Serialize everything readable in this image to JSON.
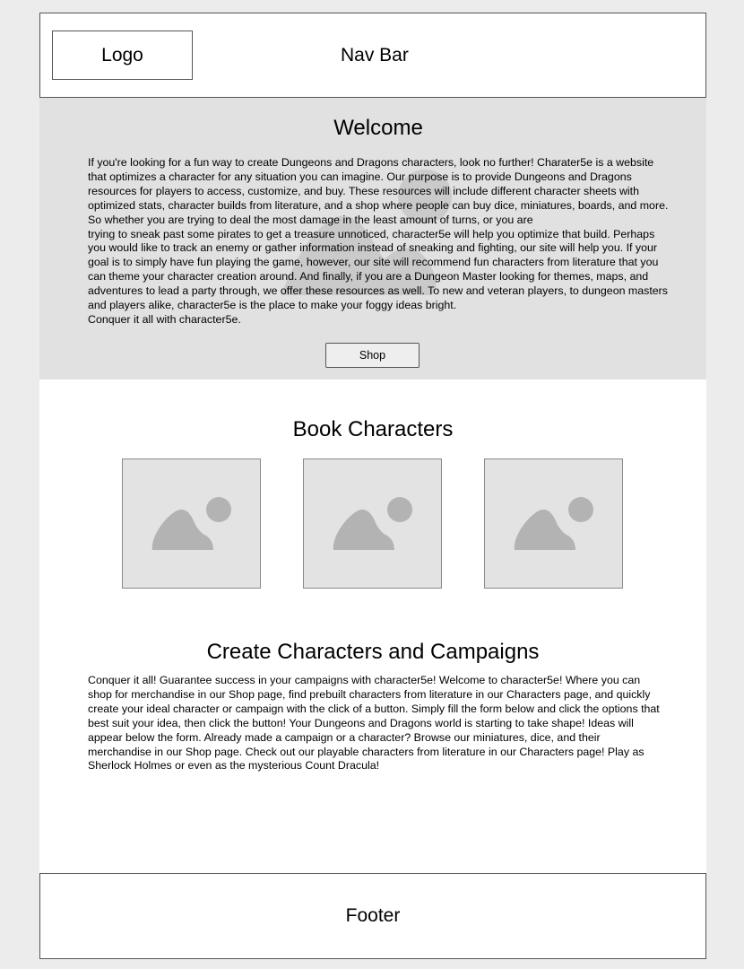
{
  "navbar": {
    "logo_label": "Logo",
    "nav_label": "Nav Bar"
  },
  "welcome": {
    "title": "Welcome",
    "body": "If you're looking for a fun way to create Dungeons and Dragons characters, look no further! Charater5e is a website\nthat optimizes a character for any situation you can imagine. Our purpose is to provide Dungeons and Dragons\nresources for players to access, customize, and buy. These resources will include different character sheets with\noptimized stats, character builds from literature, and a shop where people can buy dice, miniatures, boards, and more.\nSo whether you are trying to deal the most damage in the least amount of turns, or you are\ntrying to sneak past some pirates to get a treasure unnoticed, character5e will help you optimize that build. Perhaps\nyou would like to track an enemy or gather information instead of sneaking and fighting, our site will help you. If your\ngoal is to simply have fun playing the game, however, our site will recommend fun characters from literature that you\ncan theme your character creation around. And finally, if you are a Dungeon Master looking for themes, maps, and\nadventures to lead a party through, we offer these resources as well. To new and veteran players, to dungeon masters\nand players alike, character5e is the place to make your foggy ideas bright.\nConquer it all with character5e.",
    "shop_button": "Shop"
  },
  "book_characters": {
    "title": "Book Characters",
    "images": [
      "image-placeholder-icon",
      "image-placeholder-icon",
      "image-placeholder-icon"
    ]
  },
  "create": {
    "title": "Create Characters and Campaigns",
    "body": "Conquer it all! Guarantee success in your campaigns with character5e! Welcome to character5e! Where you can shop for merchandise in our Shop page, find prebuilt characters from literature in our Characters page, and quickly create your ideal character or campaign with the click of a button. Simply fill the form below and click the options that best suit your idea, then click the button! Your Dungeons and Dragons world is starting to take shape! Ideas will appear below the form. Already made a campaign or a character? Browse our miniatures, dice, and their merchandise in our Shop page. Check out our playable characters from literature in our Characters page! Play as Sherlock Holmes or even as the mysterious Count Dracula!"
  },
  "footer": {
    "label": "Footer"
  },
  "colors": {
    "page_background": "#ececec",
    "welcome_background": "#e1e1e1",
    "placeholder_fill": "#e3e3e3",
    "placeholder_icon": "#b3b3b3"
  }
}
